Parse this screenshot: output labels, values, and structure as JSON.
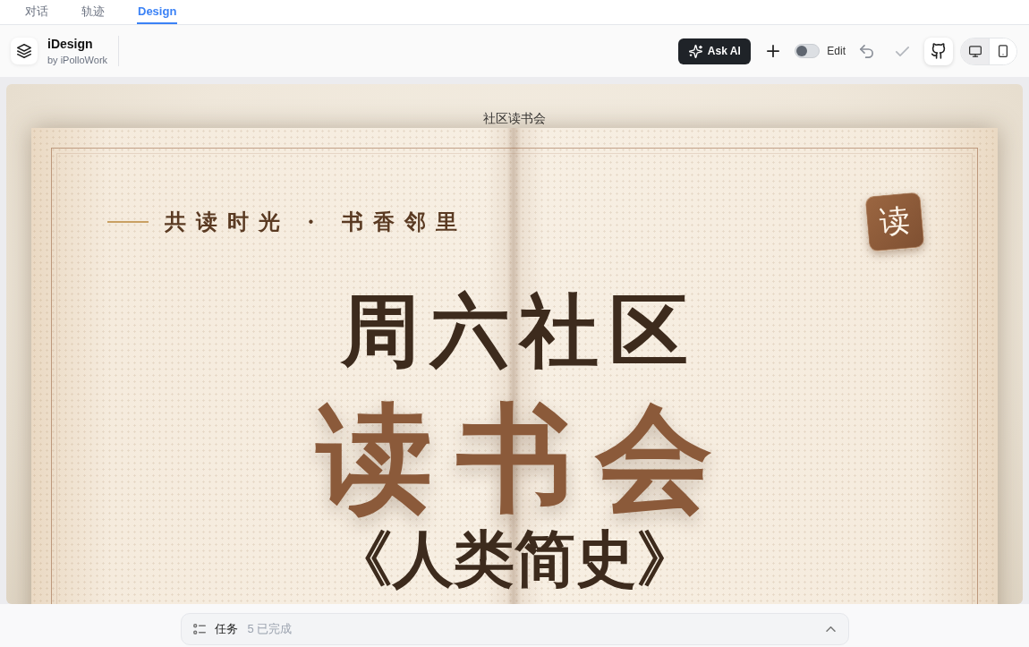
{
  "top_tabs": [
    {
      "label": "对话",
      "selected": false
    },
    {
      "label": "轨迹",
      "selected": false
    },
    {
      "label": "Design",
      "selected": true
    }
  ],
  "header": {
    "app_name": "iDesign",
    "byline": "by iPolloWork",
    "ask_ai_button": "Ask AI",
    "edit_toggle": {
      "label": "Edit",
      "on": false
    },
    "view_modes": [
      {
        "kind": "desktop",
        "selected": true
      },
      {
        "kind": "mobile",
        "selected": false
      }
    ]
  },
  "canvas": {
    "title": "社区读书会",
    "poster": {
      "tagline": "共读时光 · 书香邻里",
      "badge": "读",
      "headline": "周六社区",
      "title": "读书会",
      "book_title": "《人类简史》"
    }
  },
  "task_bar": {
    "label": "任务",
    "status": "5 已完成",
    "expanded": false
  }
}
